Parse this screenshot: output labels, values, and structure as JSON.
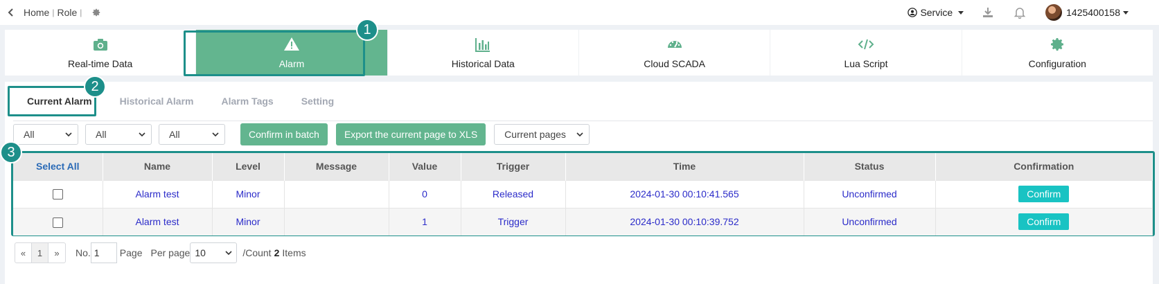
{
  "topbar": {
    "breadcrumb": [
      "Home",
      "Role"
    ],
    "service_label": "Service",
    "user_name": "1425400158"
  },
  "modules": [
    {
      "label": "Real-time Data",
      "icon": "camera-icon"
    },
    {
      "label": "Alarm",
      "icon": "warning-icon",
      "active": true
    },
    {
      "label": "Historical Data",
      "icon": "bar-chart-icon"
    },
    {
      "label": "Cloud SCADA",
      "icon": "gauge-icon"
    },
    {
      "label": "Lua Script",
      "icon": "code-icon"
    },
    {
      "label": "Configuration",
      "icon": "gear-icon"
    }
  ],
  "subtabs": [
    "Current Alarm",
    "Historical Alarm",
    "Alarm Tags",
    "Setting"
  ],
  "filters": {
    "select1": "All",
    "select2": "All",
    "select3": "All",
    "confirm_batch": "Confirm in batch",
    "export": "Export the current page to XLS",
    "scope": "Current pages"
  },
  "table": {
    "headers": [
      "Select All",
      "Name",
      "Level",
      "Message",
      "Value",
      "Trigger",
      "Time",
      "Status",
      "Confirmation"
    ],
    "rows": [
      {
        "name": "Alarm test",
        "level": "Minor",
        "message": "",
        "value": "0",
        "trigger": "Released",
        "time": "2024-01-30 00:10:41.565",
        "status": "Unconfirmed",
        "action": "Confirm"
      },
      {
        "name": "Alarm test",
        "level": "Minor",
        "message": "",
        "value": "1",
        "trigger": "Trigger",
        "time": "2024-01-30 00:10:39.752",
        "status": "Unconfirmed",
        "action": "Confirm"
      }
    ]
  },
  "pager": {
    "prev": "«",
    "page": "1",
    "next": "»",
    "no_label": "No.",
    "no_value": "1",
    "page_label": "Page",
    "per_page_label": "Per page",
    "per_page_value": "10",
    "count_prefix": "/Count",
    "count_value": "2",
    "count_suffix": "Items"
  },
  "callouts": [
    "1",
    "2",
    "3"
  ],
  "colors": {
    "accent": "#63b58f",
    "highlight": "#1d8f8a",
    "confirm": "#19c3c3",
    "link": "#2b2bc9"
  }
}
